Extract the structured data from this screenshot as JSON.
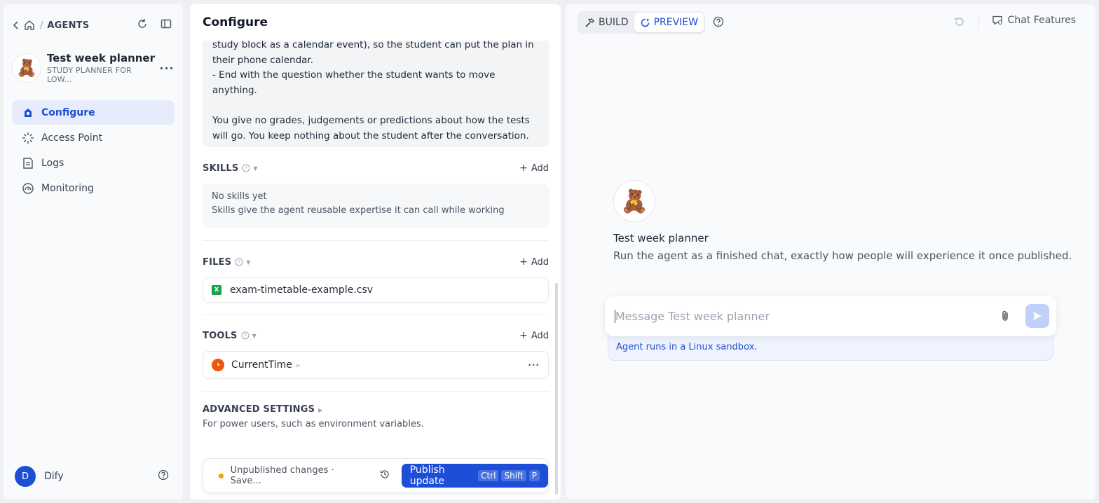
{
  "sidebar": {
    "breadcrumb_title": "AGENTS",
    "agent": {
      "avatar_emoji": "🧸",
      "name": "Test week planner",
      "subtitle": "STUDY PLANNER FOR LOW..."
    },
    "nav": [
      {
        "label": "Configure",
        "icon": "configure-icon",
        "active": true
      },
      {
        "label": "Access Point",
        "icon": "access-point-icon",
        "active": false
      },
      {
        "label": "Logs",
        "icon": "logs-icon",
        "active": false
      },
      {
        "label": "Monitoring",
        "icon": "monitoring-icon",
        "active": false
      }
    ],
    "user": {
      "initial": "D",
      "name": "Dify"
    }
  },
  "configure": {
    "title": "Configure",
    "prompt_text": "study block as a calendar event), so the student can put the plan in their phone calendar.\n- End with the question whether the student wants to move anything.\n\nYou give no grades, judgements or predictions about how the tests will go. You keep nothing about the student after the conversation.",
    "skills": {
      "title": "SKILLS",
      "add_label": "Add",
      "empty_title": "No skills yet",
      "empty_desc": "Skills give the agent reusable expertise it can call while working"
    },
    "files": {
      "title": "FILES",
      "add_label": "Add",
      "items": [
        {
          "name": "exam-timetable-example.csv",
          "icon_text": "X"
        }
      ]
    },
    "tools": {
      "title": "TOOLS",
      "add_label": "Add",
      "items": [
        {
          "name": "CurrentTime"
        }
      ]
    },
    "advanced": {
      "title": "ADVANCED SETTINGS",
      "desc": "For power users, such as environment variables."
    },
    "footer": {
      "status": "Unpublished changes · Save...",
      "publish_label": "Publish update",
      "shortcut": [
        "Ctrl",
        "Shift",
        "P"
      ]
    }
  },
  "preview": {
    "tabs": [
      {
        "label": "BUILD",
        "active": false
      },
      {
        "label": "PREVIEW",
        "active": true
      }
    ],
    "chat_features_label": "Chat Features",
    "welcome": {
      "avatar_emoji": "🧸",
      "name": "Test week planner",
      "desc": "Run the agent as a finished chat, exactly how people will experience it once published."
    },
    "input_placeholder": "Message Test week planner",
    "sandbox_note": "Agent runs in a Linux sandbox."
  },
  "colors": {
    "accent": "#1d4ed8",
    "status_warning": "#f59e0b",
    "csv_green": "#15a34a",
    "tool_orange": "#ea580c"
  }
}
